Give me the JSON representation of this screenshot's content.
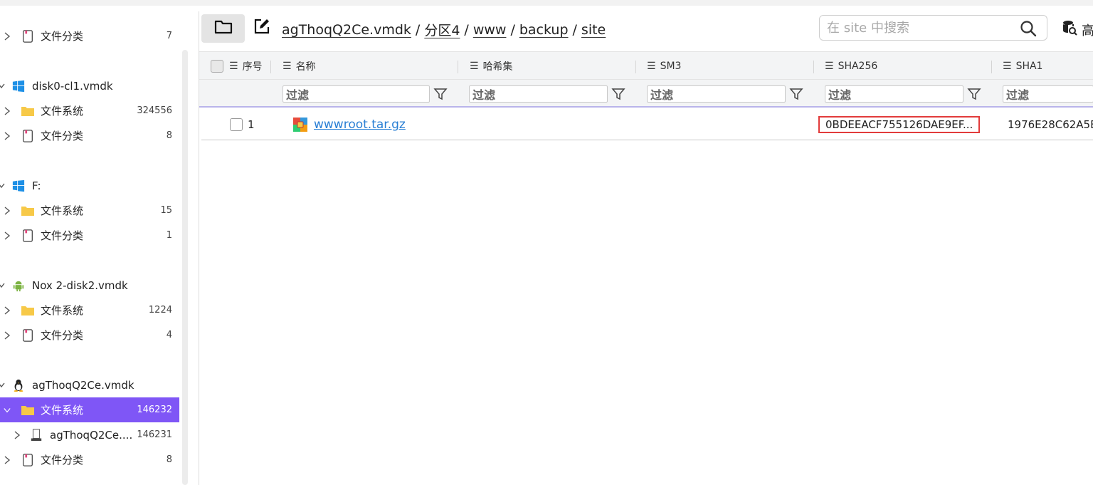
{
  "sidebar": {
    "rows": [
      {
        "label": "文件分类",
        "count": "7",
        "type": "category"
      },
      {
        "label": "disk0-cl1.vmdk",
        "count": "",
        "type": "windows-disk"
      },
      {
        "label": "文件系统",
        "count": "324556",
        "type": "filesystem"
      },
      {
        "label": "文件分类",
        "count": "8",
        "type": "category"
      },
      {
        "label": "F:",
        "count": "",
        "type": "windows-disk"
      },
      {
        "label": "文件系统",
        "count": "15",
        "type": "filesystem"
      },
      {
        "label": "文件分类",
        "count": "1",
        "type": "category"
      },
      {
        "label": "Nox 2-disk2.vmdk",
        "count": "",
        "type": "android-disk"
      },
      {
        "label": "文件系统",
        "count": "1224",
        "type": "filesystem"
      },
      {
        "label": "文件分类",
        "count": "4",
        "type": "category"
      },
      {
        "label": "agThoqQ2Ce.vmdk",
        "count": "",
        "type": "linux-disk"
      },
      {
        "label": "文件系统",
        "count": "146232",
        "type": "filesystem",
        "selected": true
      },
      {
        "label": "agThoqQ2Ce....",
        "count": "146231",
        "type": "drive"
      },
      {
        "label": "文件分类",
        "count": "8",
        "type": "category"
      }
    ]
  },
  "toolbar": {
    "breadcrumb": [
      "agThoqQ2Ce.vmdk",
      "分区4",
      "www",
      "backup",
      "site"
    ],
    "separator": "/",
    "search_placeholder": "在 site 中搜索",
    "advanced_label": "高"
  },
  "table": {
    "columns": {
      "index": "序号",
      "name": "名称",
      "hashset": "哈希集",
      "sm3": "SM3",
      "sha256": "SHA256",
      "sha1": "SHA1"
    },
    "filter_placeholder": "过滤",
    "rows": [
      {
        "index": "1",
        "name": "wwwroot.tar.gz",
        "hashset": "",
        "sm3": "",
        "sha256": "0BDEEACF755126DAE9EF...",
        "sha1": "1976E28C62A5E"
      }
    ]
  },
  "colors": {
    "selected_bg": "#7f56f6",
    "link": "#2a7fd4",
    "highlight_border": "#e23b3b",
    "windows_blue": "#1e90e6",
    "android_green": "#7cb342",
    "folder_yellow": "#f7c948"
  }
}
